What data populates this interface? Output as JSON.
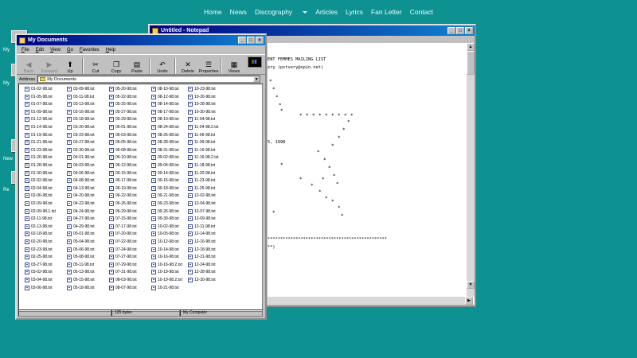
{
  "nav": {
    "items": [
      "Home",
      "News",
      "Discography",
      "Articles",
      "Lyrics",
      "Fan Letter",
      "Contact"
    ]
  },
  "desktop": {
    "labels": [
      "My",
      "My",
      "New",
      "Re"
    ]
  },
  "explorer": {
    "title": "My Documents",
    "menu": [
      "File",
      "Edit",
      "View",
      "Go",
      "Favorites",
      "Help"
    ],
    "toolbar": [
      "Back",
      "Forward",
      "Up",
      "Cut",
      "Copy",
      "Paste",
      "Undo",
      "Delete",
      "Properties",
      "Views"
    ],
    "address_label": "Address",
    "address_value": "My Documents",
    "files": [
      "01-02-98.txt",
      "01-05-98.txt",
      "01-07-98.txt",
      "01-09-98.txt",
      "01-12-98.txt",
      "01-14-98.txt",
      "01-19-98.txt",
      "01-21-98.txt",
      "01-23-98.txt",
      "01-26-98.txt",
      "01-28-98.txt",
      "01-30-98.txt",
      "02-02-98.txt",
      "02-04-98.txt",
      "02-06-98.txt",
      "02-09-98.txt",
      "02-09-98.1.txt",
      "02-11-98.txt",
      "02-13-98.txt",
      "02-18-98.txt",
      "02-20-98.txt",
      "02-23-98.txt",
      "02-25-98.txt",
      "03-27-98.txt",
      "03-02-98.txt",
      "03-04-98.txt",
      "03-06-98.txt",
      "03-09-98.txt",
      "03-11-98.txt",
      "03-13-98.txt",
      "03-16-98.txt",
      "03-18-98.txt",
      "03-20-98.txt",
      "03-23-98.txt",
      "03-27-98.txt",
      "03-30-98.txt",
      "04-01-98.txt",
      "04-03-98.txt",
      "04-06-98.txt",
      "04-08-98.txt",
      "04-13-98.txt",
      "04-20-98.txt",
      "04-22-98.txt",
      "04-24-98.txt",
      "04-27-98.txt",
      "04-29-98.txt",
      "05-01-98.txt",
      "05-04-98.txt",
      "05-06-98.txt",
      "05-08-98.txt",
      "05-11-98.txt",
      "05-13-98.txt",
      "05-15-98.txt",
      "05-18-98.txt",
      "05-20-98.txt",
      "05-22-98.txt",
      "05-25-98.txt",
      "05-27-98.txt",
      "05-29-98.txt",
      "06-01-98.txt",
      "06-03-98.txt",
      "06-05-98.txt",
      "06-08-98.txt",
      "06-10-98.txt",
      "06-12-98.txt",
      "06-15-98.txt",
      "06-17-98.txt",
      "06-19-98.txt",
      "06-22-98.txt",
      "06-26-98.txt",
      "06-29-98.txt",
      "07-15-98.txt",
      "07-17-98.txt",
      "07-20-98.txt",
      "07-22-98.txt",
      "07-24-98.txt",
      "07-27-98.txt",
      "07-29-98.txt",
      "07-31-98.txt",
      "08-03-98.txt",
      "08-07-98.txt",
      "08-10-98.txt",
      "08-12-98.txt",
      "08-14-98.txt",
      "08-17-98.txt",
      "08-19-98.txt",
      "08-24-98.txt",
      "08-26-98.txt",
      "08-28-98.txt",
      "08-31-98.txt",
      "09-02-98.txt",
      "09-04-98.txt",
      "09-14-98.txt",
      "09-16-98.txt",
      "09-18-98.txt",
      "09-21-98.txt",
      "09-23-98.txt",
      "09-26-98.txt",
      "09-30-98.txt",
      "10-02-98.txt",
      "10-05-98.txt",
      "10-12-98.txt",
      "10-14-98.txt",
      "10-16-98.txt",
      "10-16-98.2.txt",
      "10-19-98.txt",
      "10-19-98.2.txt",
      "10-21-98.txt",
      "10-23-98.txt",
      "10-26-98.txt",
      "10-28-98.txt",
      "10-30-98.txt",
      "11-04-98.txt",
      "11-04-98.2.txt",
      "11-06-98.txt",
      "11-09-98.txt",
      "11-16-98.txt",
      "11-16-98.2.txt",
      "11-18-98.txt",
      "11-20-98.txt",
      "11-23-98.txt",
      "11-25-98.txt",
      "12-02-98.txt",
      "12-04-98.txt",
      "12-07-98.txt",
      "12-09-98.txt",
      "12-11-98.txt",
      "12-14-98.txt",
      "12-16-98.txt",
      "12-18-98.txt",
      "12-21-98.txt",
      "12-24-98.txt",
      "12-28-98.txt",
      "12-30-98.txt"
    ],
    "status_size": "125 bytes",
    "status_location": "My Computer"
  },
  "notepad": {
    "title": "Untitled - Notepad",
    "lines": [
      "ENT FEMMES MAILING LIST",
      "ery (pstvery@spin.net)",
      "5, 1998",
      "***********************************************",
      "**)"
    ]
  },
  "colors": {
    "desktop": "#0e9191",
    "titlebar": "#000080",
    "window": "#c0c0c0"
  }
}
